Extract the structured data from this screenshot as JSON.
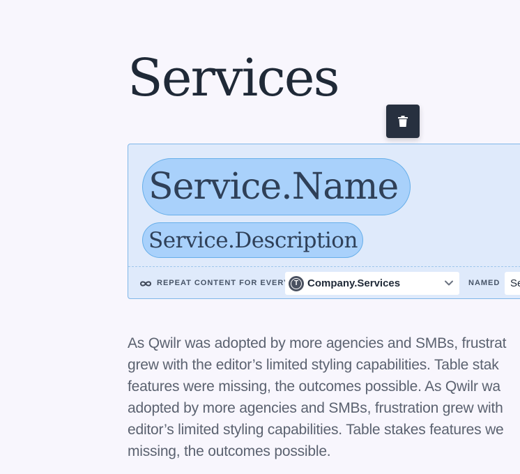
{
  "page": {
    "title": "Services"
  },
  "toolbar": {
    "delete_icon": "trash-icon"
  },
  "repeat_block": {
    "tokens": {
      "name": "Service.Name",
      "description": "Service.Description"
    },
    "repeat_label": "REPEAT CONTENT FOR EVERY",
    "loop_icon": "infinity-icon",
    "source": {
      "icon": "t-circle-icon",
      "value": "Company.Services"
    },
    "named_label": "NAMED",
    "named_value": "Se"
  },
  "body": {
    "lines": [
      "As Qwilr was adopted by more agencies and SMBs, frustrat",
      "grew with the editor’s limited styling capabilities. Table stak",
      "features were missing, the outcomes possible. As Qwilr wa",
      "adopted by more agencies and SMBs, frustration grew with",
      "editor’s limited styling capabilities. Table stakes features we",
      "missing, the outcomes possible."
    ]
  },
  "colors": {
    "background": "#f8f6fd",
    "title": "#1f2937",
    "block_fill": "#dfeafb",
    "block_border": "#7fb6e8",
    "token_fill": "#a9d1fb",
    "token_border": "#66aee9",
    "delete_button": "#27303f"
  }
}
